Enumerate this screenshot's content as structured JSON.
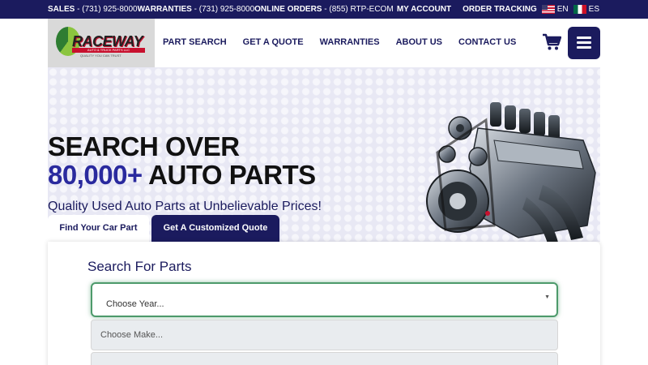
{
  "topbar": {
    "sales_label": "SALES",
    "sales_phone": "- (731) 925-8000",
    "warranties_label": "WARRANTIES",
    "warranties_phone": "- (731) 925-8000",
    "online_label": "ONLINE ORDERS",
    "online_phone": "- (855) RTP-ECOM",
    "my_account": "MY ACCOUNT",
    "order_tracking": "ORDER TRACKING",
    "lang_en": "EN",
    "lang_es": "ES"
  },
  "logo": {
    "wordmark": "RACEWAY",
    "subline": "AUTO & TRUCK PARTS LLC",
    "tagline": "QUALITY YOU CAN TRUST"
  },
  "nav": {
    "items": [
      "PART SEARCH",
      "GET A QUOTE",
      "WARRANTIES",
      "ABOUT US",
      "CONTACT US"
    ]
  },
  "hero": {
    "line1": "SEARCH OVER",
    "count": "80,000+",
    "line2_rest": " AUTO PARTS",
    "subtitle": "Quality Used Auto Parts at Unbelievable Prices!"
  },
  "tabs": {
    "find": "Find Your Car Part",
    "quote": "Get A Customized Quote"
  },
  "search": {
    "heading": "Search For Parts",
    "year_placeholder": "Choose Year...",
    "make_placeholder": "Choose Make...",
    "model_placeholder": ""
  },
  "colors": {
    "navy": "#1b1b5e",
    "accent_blue": "#2a2a9e",
    "focus_green": "#4d9a6b"
  },
  "icons": {
    "cart": "cart-icon",
    "menu": "hamburger-menu-icon",
    "caret": "chevron-down-icon"
  }
}
